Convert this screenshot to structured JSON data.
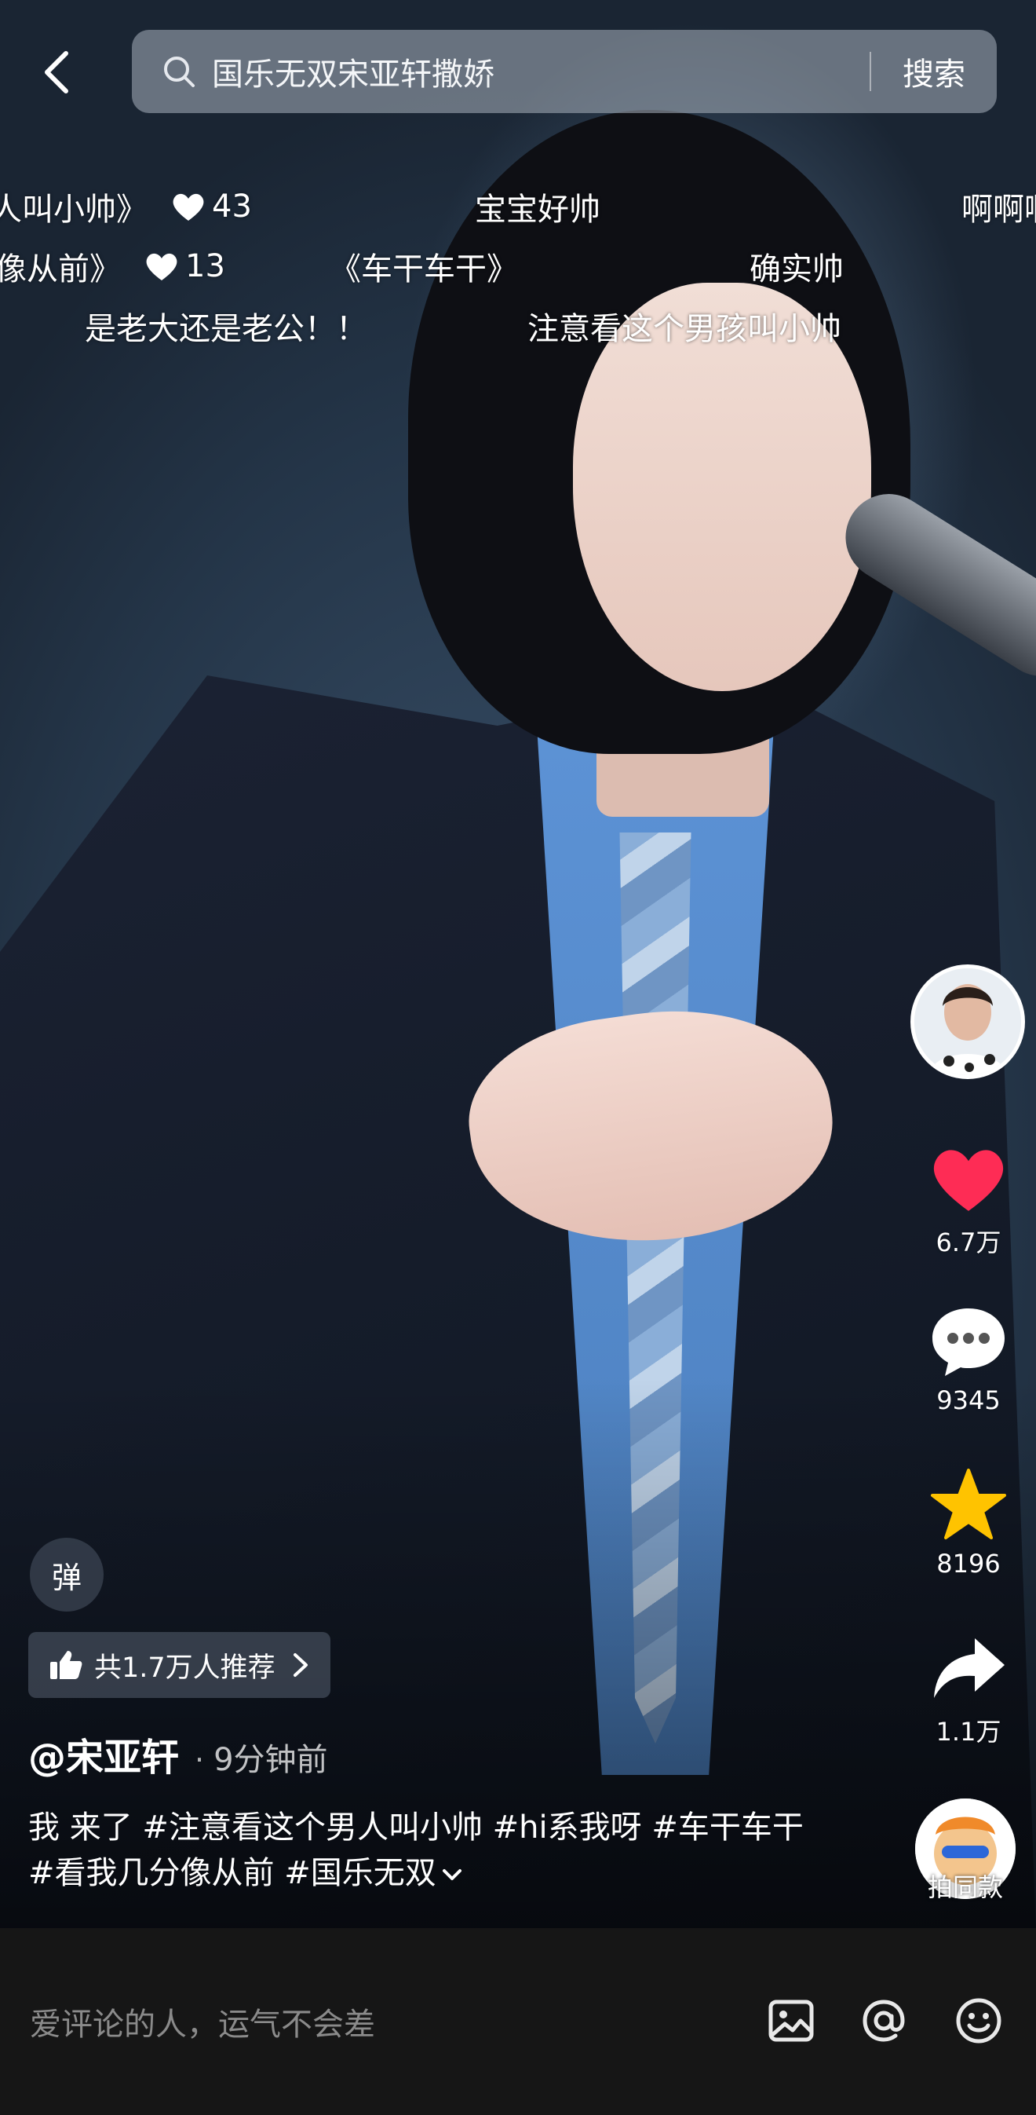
{
  "search": {
    "query": "国乐无双宋亚轩撒娇",
    "button_label": "搜索"
  },
  "danmaku": [
    {
      "text": "人叫小帅》",
      "likes": "43"
    },
    {
      "text": "宝宝好帅"
    },
    {
      "text": "啊啊啊"
    },
    {
      "text": "像从前》",
      "likes": "13"
    },
    {
      "text": "《车干车干》"
    },
    {
      "text": "确实帅"
    },
    {
      "text": "是老大还是老公！！"
    },
    {
      "text": "注意看这个男孩叫小帅"
    }
  ],
  "actions": {
    "likes": "6.7万",
    "comments": "9345",
    "favorites": "8196",
    "shares": "1.1万",
    "same_style_label": "拍同款"
  },
  "danmu_toggle_label": "弹",
  "recommend_label": "共1.7万人推荐",
  "author": {
    "name": "@宋亚轩",
    "dot": "·",
    "time": "9分钟前"
  },
  "caption": "我 来了 #注意看这个男人叫小帅 #hi系我呀 #车干车干 #看我几分像从前 #国乐无双",
  "comment_bar": {
    "placeholder": "爱评论的人，运气不会差"
  },
  "icons": [
    "back-arrow-icon",
    "search-icon",
    "heart-icon",
    "comment-icon",
    "star-icon",
    "share-icon",
    "thumb-up-icon",
    "chevron-right-icon",
    "chevron-down-icon",
    "image-icon",
    "at-icon",
    "emoji-icon"
  ],
  "colors": {
    "like_red": "#fe2c55",
    "favorite_yellow": "#ffc300",
    "comment_bar_bg": "#161616"
  }
}
